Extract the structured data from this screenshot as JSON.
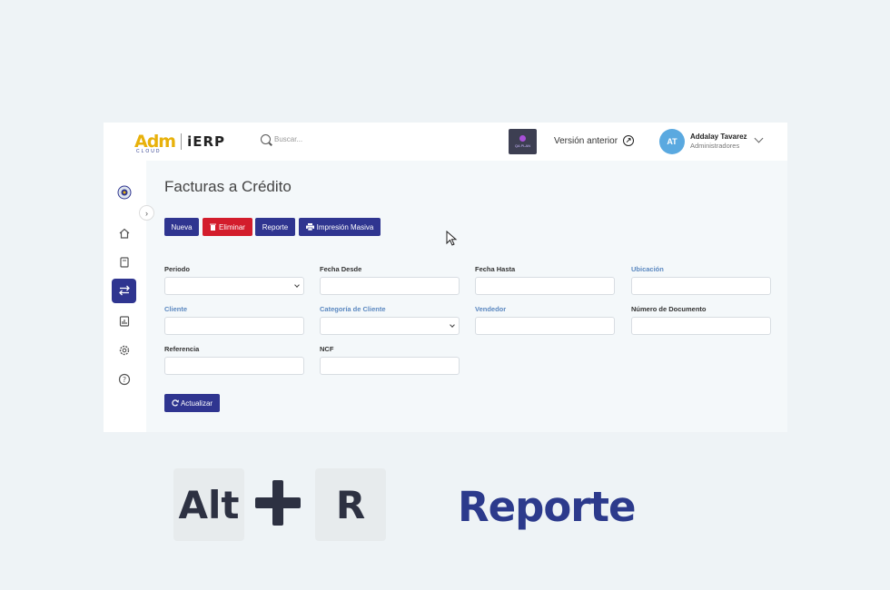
{
  "header": {
    "logo_brand": "Adm",
    "logo_cloud": "CLOUD",
    "logo_product": "iERP",
    "search_placeholder": "Buscar...",
    "env_badge": "QA PLAN",
    "version_link": "Versión anterior",
    "user": {
      "initials": "AT",
      "name": "Addalay Tavarez",
      "role": "Administradores"
    }
  },
  "sidebar": {
    "items": [
      {
        "icon": "company-logo-icon"
      },
      {
        "icon": "home-icon"
      },
      {
        "icon": "book-icon"
      },
      {
        "icon": "transfer-arrows-icon",
        "active": true
      },
      {
        "icon": "report-chart-icon"
      },
      {
        "icon": "gear-icon"
      },
      {
        "icon": "help-icon"
      }
    ],
    "expand_glyph": "›"
  },
  "page": {
    "title": "Facturas a Crédito",
    "toolbar": {
      "nueva": "Nueva",
      "eliminar": "Eliminar",
      "reporte": "Reporte",
      "impresion": "Impresión Masiva"
    },
    "filters": {
      "periodo": "Periodo",
      "fecha_desde": "Fecha Desde",
      "fecha_hasta": "Fecha Hasta",
      "ubicacion": "Ubicación",
      "cliente": "Cliente",
      "categoria_cliente": "Categoría de Cliente",
      "vendedor": "Vendedor",
      "numero_documento": "Número de Documento",
      "referencia": "Referencia",
      "ncf": "NCF"
    },
    "actualizar": "Actualizar"
  },
  "shortcut": {
    "key1": "Alt",
    "key2": "R",
    "action": "Reporte"
  },
  "colors": {
    "primary": "#2f3590",
    "danger": "#d31d2c",
    "link_label": "#5b88c0",
    "caption": "#2c3a8c"
  }
}
